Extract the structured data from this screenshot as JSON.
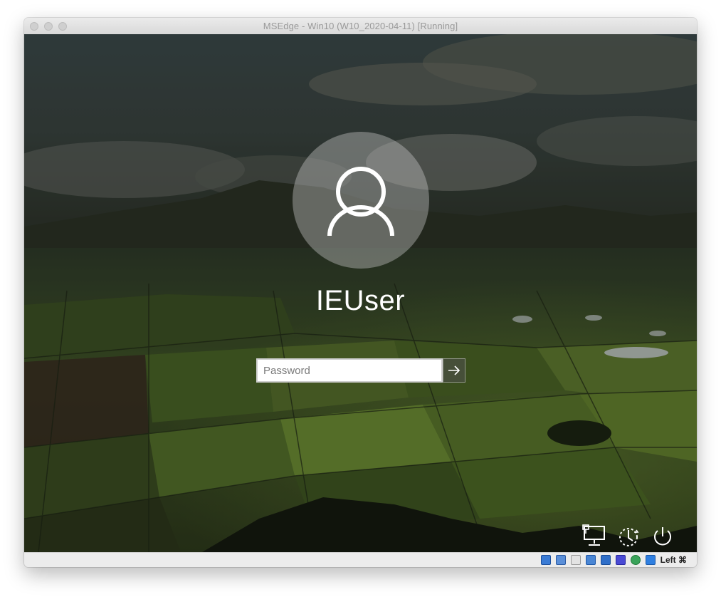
{
  "window": {
    "title": "MSEdge - Win10 (W10_2020-04-11) [Running]"
  },
  "login": {
    "username": "IEUser",
    "password_placeholder": "Password",
    "password_value": ""
  },
  "corner_icons": [
    "network-icon",
    "ease-of-access-icon",
    "power-icon"
  ],
  "status_bar": {
    "icons": [
      "hard-disk-icon",
      "network-adapter-icon",
      "optical-drive-icon",
      "display-icon",
      "shared-folder-icon",
      "video-capture-icon",
      "usb-icon",
      "mouse-integration-icon"
    ],
    "host_key_label": "Left ⌘"
  },
  "colors": {
    "field_green": "#4f6b2a",
    "sky_dark": "#2b3532",
    "status_bar_bg": "#ececec"
  }
}
